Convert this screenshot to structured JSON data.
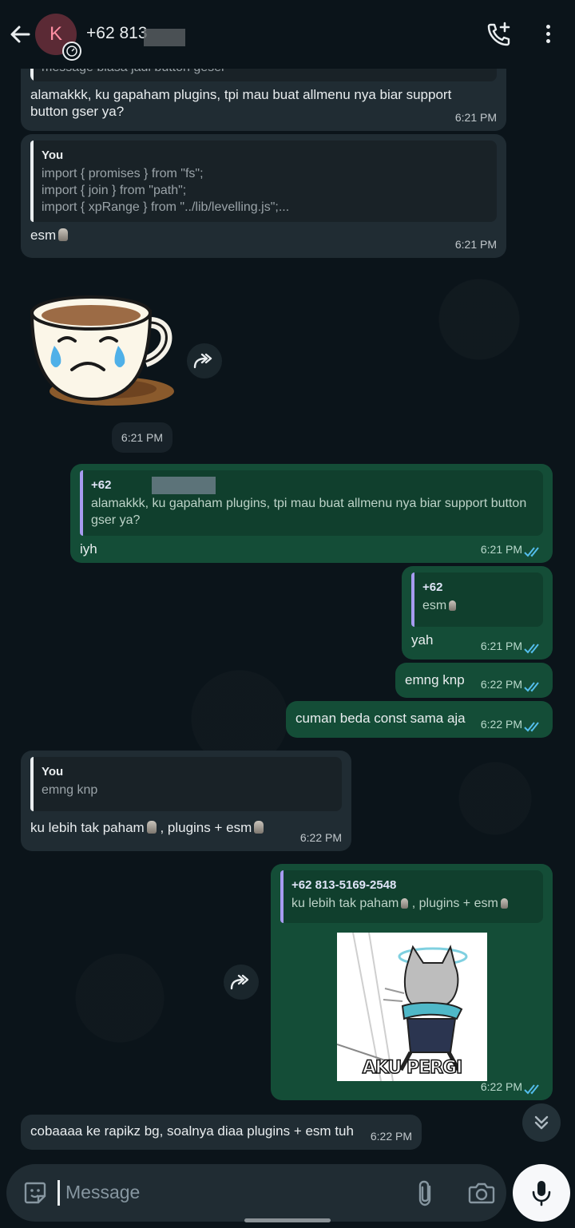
{
  "header": {
    "avatar_letter": "K",
    "contact_title": "+62 813",
    "call_icon": "phone-plus-icon",
    "menu_icon": "more-vert-icon"
  },
  "messages": {
    "m1": {
      "quote_partial": "message biasa jadi button geser",
      "text": "alamakkk, ku gapaham plugins, tpi mau buat allmenu nya biar support button gser  ya?",
      "time": "6:21 PM"
    },
    "m2": {
      "quote_author": "You",
      "quote_text": "import { promises } from \"fs\";\nimport { join } from \"path\";\nimport { xpRange } from \"../lib/levelling.js\";...",
      "text": "esm",
      "time": "6:21 PM"
    },
    "sticker1": {
      "time": "6:21 PM"
    },
    "m3": {
      "quote_author": "+62",
      "quote_text": "alamakkk, ku gapaham plugins, tpi mau buat allmenu nya biar support button gser  ya?",
      "text": "iyh",
      "time": "6:21 PM"
    },
    "m4": {
      "quote_author": "+62",
      "quote_text": "esm",
      "text": "yah",
      "time": "6:21 PM"
    },
    "m5": {
      "text": "emng knp",
      "time": "6:22 PM"
    },
    "m6": {
      "text": "cuman beda const sama aja",
      "time": "6:22 PM"
    },
    "m7": {
      "quote_author": "You",
      "quote_text": "emng knp",
      "text_a": "ku lebih tak paham",
      "text_b": ", plugins + esm",
      "time": "6:22 PM"
    },
    "m8": {
      "quote_author": "+62 813-5169-2548",
      "quote_text_a": "ku lebih tak paham",
      "quote_text_b": ", plugins + esm",
      "sticker_caption": "AKU PERGI",
      "time": "6:22 PM"
    },
    "m9": {
      "text": "cobaaaa ke rapikz bg, soalnya diaa plugins + esm tuh",
      "time": "6:22 PM"
    }
  },
  "input": {
    "placeholder": "Message"
  },
  "colors": {
    "background": "#0b141a",
    "incoming_bubble": "#202c33",
    "outgoing_bubble": "#144d37",
    "read_ticks": "#53bdeb"
  }
}
